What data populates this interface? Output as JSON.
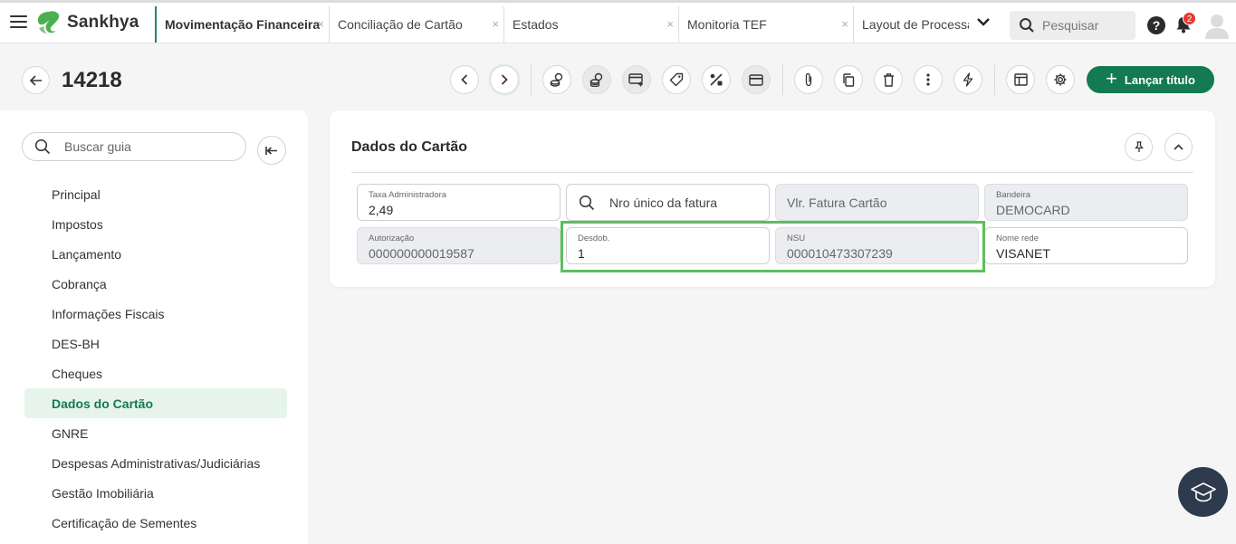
{
  "app": {
    "brand": "Sankhya",
    "brand_color": "#1f8a5b",
    "search_placeholder": "Pesquisar",
    "help_label": "?",
    "notification_count": "2"
  },
  "tabs": [
    {
      "label": "Movimentação Financeira",
      "active": true
    },
    {
      "label": "Conciliação de Cartão",
      "active": false
    },
    {
      "label": "Estados",
      "active": false
    },
    {
      "label": "Monitoria TEF",
      "active": false
    },
    {
      "label": "Layout de Processar",
      "active": false
    }
  ],
  "tab_close_glyph": "×",
  "record": {
    "id": "14218"
  },
  "toolbar": {
    "primary_label": "Lançar título",
    "primary_color": "#137a51",
    "icons": [
      "chevron-left-icon",
      "chevron-right-icon",
      "coins-icon",
      "coins-stack-icon",
      "card-add-icon",
      "tag-icon",
      "percent-icon",
      "credit-card-icon",
      "paperclip-icon",
      "copy-icon",
      "trash-icon",
      "more-vertical-icon",
      "lightning-icon",
      "table-icon",
      "gear-icon"
    ]
  },
  "sidebar": {
    "search_placeholder": "Buscar guia",
    "items": [
      {
        "label": "Principal"
      },
      {
        "label": "Impostos"
      },
      {
        "label": "Lançamento"
      },
      {
        "label": "Cobrança"
      },
      {
        "label": "Informações Fiscais"
      },
      {
        "label": "DES-BH"
      },
      {
        "label": "Cheques"
      },
      {
        "label": "Dados do Cartão",
        "active": true
      },
      {
        "label": "GNRE"
      },
      {
        "label": "Despesas Administrativas/Judiciárias"
      },
      {
        "label": "Gestão Imobiliária"
      },
      {
        "label": "Certificação de Sementes"
      }
    ]
  },
  "card": {
    "title": "Dados do Cartão",
    "fields": {
      "taxa_adm": {
        "label": "Taxa Administradora",
        "value": "2,49"
      },
      "nro_unico": {
        "placeholder": "Nro único da fatura"
      },
      "vlr_fatura": {
        "placeholder": "Vlr. Fatura Cartão"
      },
      "bandeira": {
        "label": "Bandeira",
        "value": "DEMOCARD"
      },
      "autorizacao": {
        "label": "Autorização",
        "value": "000000000019587"
      },
      "desdob": {
        "label": "Desdob.",
        "value": "1"
      },
      "nsu": {
        "label": "NSU",
        "value": "000010473307239"
      },
      "nome_rede": {
        "label": "Nome rede",
        "value": "VISANET"
      }
    },
    "highlight_color": "#5dbf5d"
  }
}
